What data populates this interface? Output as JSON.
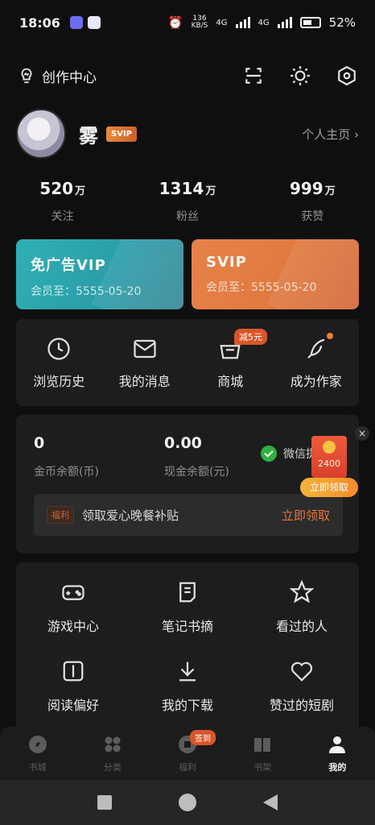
{
  "status": {
    "time": "18:06",
    "speed_value": "136",
    "speed_unit": "KB/S",
    "network_1": "4G",
    "network_2": "4G",
    "battery_percent": "52%"
  },
  "header": {
    "creator_center": "创作中心",
    "icons": [
      "scan-icon",
      "brightness-icon",
      "settings-icon"
    ]
  },
  "profile": {
    "nickname": "雾",
    "badge": "SVIP",
    "homepage_link": "个人主页 ›"
  },
  "stats": [
    {
      "value": "520",
      "unit": "万",
      "label": "关注"
    },
    {
      "value": "1314",
      "unit": "万",
      "label": "粉丝"
    },
    {
      "value": "999",
      "unit": "万",
      "label": "获赞"
    }
  ],
  "vip_cards": [
    {
      "name": "免广告VIP",
      "expiry": "会员至：5555-05-20"
    },
    {
      "name": "SVIP",
      "expiry": "会员至：5555-05-20"
    }
  ],
  "quick_actions": [
    {
      "label": "浏览历史",
      "icon": "clock-icon"
    },
    {
      "label": "我的消息",
      "icon": "mail-icon"
    },
    {
      "label": "商城",
      "icon": "shop-icon",
      "tag": "减5元"
    },
    {
      "label": "成为作家",
      "icon": "quill-icon"
    }
  ],
  "wallet": {
    "coin_amount": "0",
    "coin_label": "金币余额(币)",
    "cash_amount": "0.00",
    "cash_label": "现金余额(元)",
    "wechat_label": "微信提",
    "welfare_tag": "福利",
    "welfare_text": "领取爱心晚餐补贴",
    "welfare_cta": "立即领取"
  },
  "red_packet": {
    "value": "2400",
    "claim": "立即领取",
    "close": "×"
  },
  "tools": [
    {
      "label": "游戏中心",
      "icon": "gamepad-icon"
    },
    {
      "label": "笔记书摘",
      "icon": "note-icon"
    },
    {
      "label": "看过的人",
      "icon": "star-icon"
    },
    {
      "label": "阅读偏好",
      "icon": "book-icon"
    },
    {
      "label": "我的下载",
      "icon": "download-icon"
    },
    {
      "label": "赞过的短剧",
      "icon": "heart-icon"
    }
  ],
  "tabbar": {
    "tabs": [
      {
        "label": "书城",
        "icon": "compass-icon"
      },
      {
        "label": "分类",
        "icon": "grid-icon"
      },
      {
        "label": "福利",
        "icon": "gift-icon",
        "tag": "签到"
      },
      {
        "label": "书架",
        "icon": "bookshelf-icon"
      },
      {
        "label": "我的",
        "icon": "person-icon",
        "active": true
      }
    ]
  },
  "colors": {
    "accent_orange": "#e4753f",
    "vip_teal": "#2fb0b3",
    "svip_orange": "#e6824a",
    "background": "#0f0f0f",
    "panel": "#1d1d1d"
  }
}
